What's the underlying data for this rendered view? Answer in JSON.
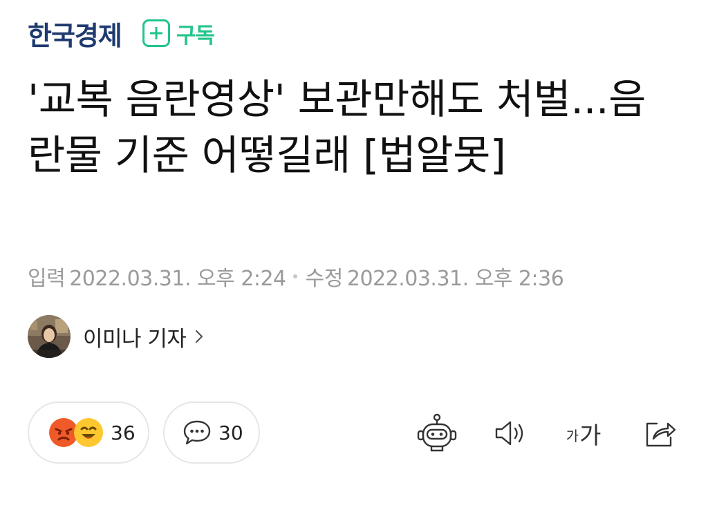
{
  "header": {
    "publisher": "한국경제",
    "subscribe_label": "구독"
  },
  "article": {
    "headline": "'교복 음란영상' 보관만해도 처벌...음란물 기준 어떻길래 [법알못]",
    "published_label": "입력",
    "published_at": "2022.03.31. 오후 2:24",
    "modified_label": "수정",
    "modified_at": "2022.03.31. 오후 2:36"
  },
  "reporter": {
    "name": "이미나 기자"
  },
  "actions": {
    "reaction_count": "36",
    "comment_count": "30",
    "font_small_glyph": "가",
    "font_big_glyph": "가"
  },
  "colors": {
    "brand": "#1e3a6e",
    "subscribe_green": "#22c48a",
    "meta_gray": "#9a9a9a",
    "angry_emoji": "#f05a28",
    "smile_emoji": "#fdc730"
  },
  "icons": {
    "subscribe": "plus-icon",
    "reporter_link": "chevron-right-icon",
    "reactions": [
      "angry-face-icon",
      "smile-face-icon"
    ],
    "comments": "speech-bubble-icon",
    "summary": "robot-icon",
    "text_to_speech": "speaker-icon",
    "font_size": "font-size-icon",
    "share": "share-icon"
  }
}
